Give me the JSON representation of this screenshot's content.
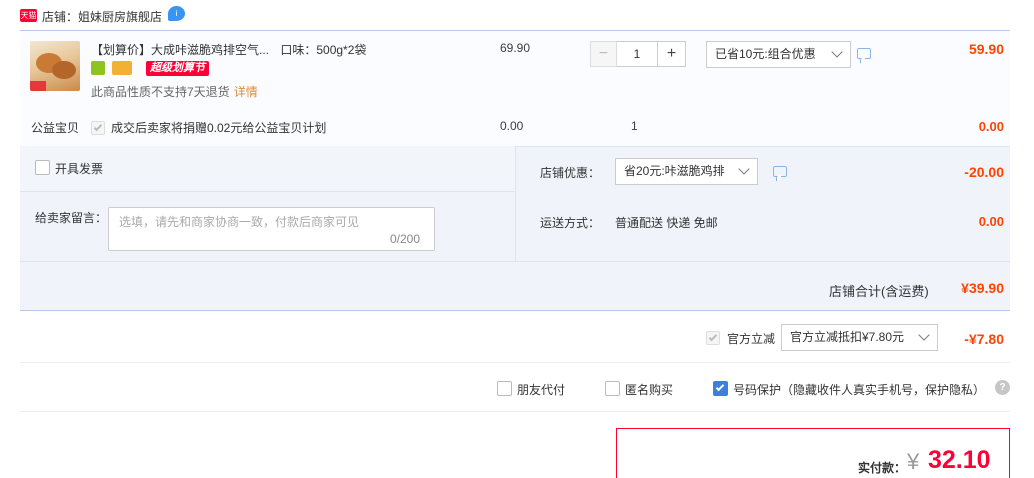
{
  "header": {
    "tmall_badge": "天猫",
    "store_prefix": "店铺：",
    "store_name": "姐妹厨房旗舰店"
  },
  "item": {
    "title": "【划算价】大成咔滋脆鸡排空气...",
    "flavor": "口味：500g*2袋",
    "promo_tag": "超级划算节",
    "return_note": "此商品性质不支持7天退货",
    "return_link": "详情",
    "unit_price": "69.90",
    "qty_minus": "−",
    "quantity": "1",
    "qty_plus": "+",
    "promo_option": "已省10元:组合优惠",
    "total": "59.90"
  },
  "charity": {
    "label": "公益宝贝",
    "text": "成交后卖家将捐赠0.02元给公益宝贝计划",
    "price": "0.00",
    "qty": "1",
    "total": "0.00"
  },
  "options": {
    "invoice_label": "开具发票",
    "remark_label": "给卖家留言：",
    "remark_placeholder": "选填，请先和商家协商一致，付款后商家可见",
    "remark_count": "0/200",
    "store_discount_label": "店铺优惠：",
    "store_discount_option": "省20元:咔滋脆鸡排",
    "store_discount_amount": "-20.00",
    "shipping_label": "运送方式：",
    "shipping_value": "普通配送 快递 免邮",
    "shipping_amount": "0.00",
    "store_sum_label": "店铺合计(含运费)",
    "store_sum_value": "¥39.90"
  },
  "official": {
    "label": "官方立减",
    "option": "官方立减抵扣¥7.80元",
    "amount": "-¥7.80"
  },
  "extras": {
    "friend_pay": "朋友代付",
    "anonymous": "匿名购买",
    "number_protect": "号码保护（隐藏收件人真实手机号，保护隐私）",
    "help": "?"
  },
  "pay": {
    "label": "实付款：",
    "currency": "¥",
    "amount": "32.10"
  },
  "colors": {
    "accent_red": "#ff0036",
    "price_orange": "#ff4400",
    "panel_blue": "#f0f4fa",
    "border_blue": "#b6c9e6"
  }
}
